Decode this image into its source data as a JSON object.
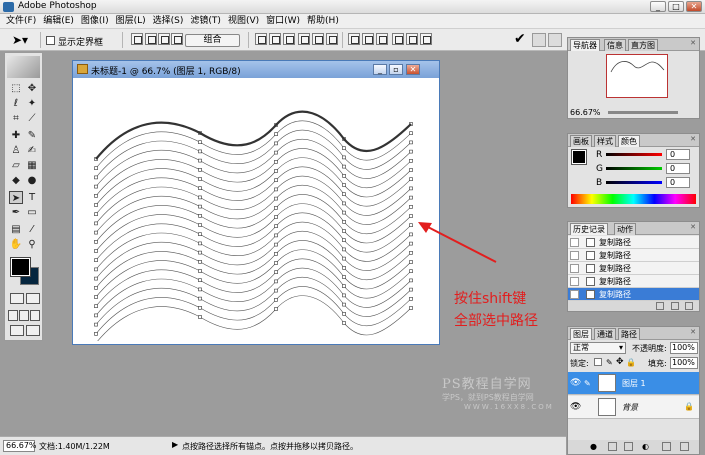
{
  "app": {
    "title": "Adobe Photoshop"
  },
  "menu": [
    "文件(F)",
    "编辑(E)",
    "图像(I)",
    "图层(L)",
    "选择(S)",
    "滤镜(T)",
    "视图(V)",
    "窗口(W)",
    "帮助(H)"
  ],
  "options": {
    "show_bbox_label": "显示定界框",
    "combine_label": "组合"
  },
  "document": {
    "title": "未标题-1 @ 66.7% (图层 1, RGB/8)"
  },
  "annotation": {
    "line1": "按住shift键",
    "line2": "全部选中路径",
    "color": "#e21e1e"
  },
  "watermark": {
    "line1": "PS教程自学网",
    "line2": "学PS，就到PS教程自学网",
    "line3": "WWW.16XX8.COM"
  },
  "navigator": {
    "tabs": [
      "导航器",
      "信息",
      "直方图"
    ],
    "zoom": "66.67%"
  },
  "color_panel": {
    "tabs": [
      "画板",
      "样式",
      "颜色"
    ],
    "channels": [
      {
        "label": "R",
        "value": "0"
      },
      {
        "label": "G",
        "value": "0"
      },
      {
        "label": "B",
        "value": "0"
      }
    ]
  },
  "history": {
    "tabs": [
      "历史记录",
      "动作"
    ],
    "items": [
      "复制路径",
      "复制路径",
      "复制路径",
      "复制路径",
      "复制路径"
    ]
  },
  "layers": {
    "tabs": [
      "图层",
      "通道",
      "路径"
    ],
    "blend_mode": "正常",
    "opacity_label": "不透明度:",
    "opacity": "100%",
    "lock_label": "锁定:",
    "fill_label": "填充:",
    "fill": "100%",
    "items": [
      {
        "name": "图层 1",
        "selected": true
      },
      {
        "name": "背景",
        "selected": false
      }
    ]
  },
  "status": {
    "zoom": "66.67%",
    "doc": "文档:1.40M/1.22M",
    "message": "点按路径选择所有锚点。点按并拖移以拷贝路径。"
  }
}
